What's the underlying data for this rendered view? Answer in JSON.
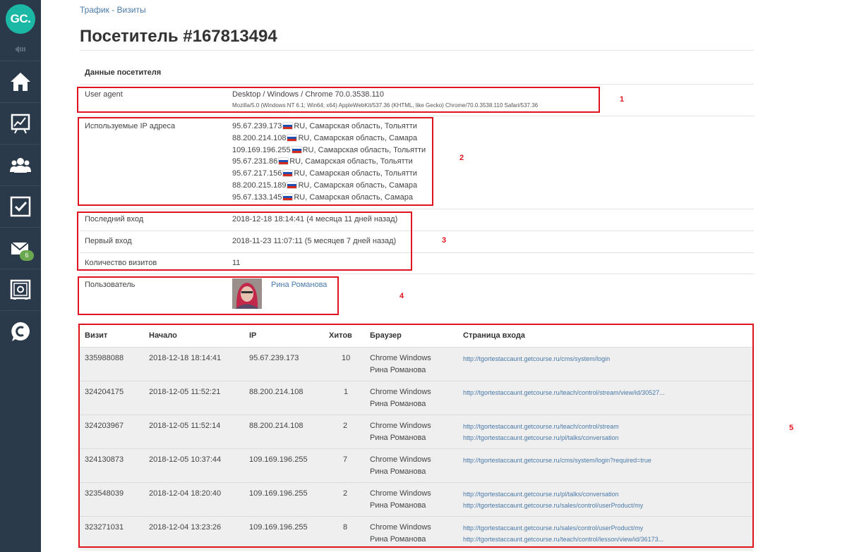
{
  "sidebar": {
    "logo_text": "GC.",
    "items": [
      {
        "icon": "home-icon"
      },
      {
        "icon": "chart-icon"
      },
      {
        "icon": "users-icon"
      },
      {
        "icon": "tasks-icon"
      },
      {
        "icon": "mail-icon",
        "badge": "6"
      },
      {
        "icon": "safe-icon"
      },
      {
        "icon": "chat-icon"
      }
    ],
    "bg_color": "#2b3a4a",
    "logo_color": "#1bb8a6"
  },
  "breadcrumb": {
    "item1": "Трафик",
    "sep": "-",
    "item2": "Визиты"
  },
  "page_title": "Посетитель #167813494",
  "visitor": {
    "section_title": "Данные посетителя",
    "user_agent_label": "User agent",
    "user_agent_short": "Desktop / Windows / Chrome 70.0.3538.110",
    "user_agent_full": "Mozilla/5.0 (Windows NT 6.1; Win64; x64) AppleWebKit/537.36 (KHTML, like Gecko) Chrome/70.0.3538.110 Safari/537.36",
    "ips_label": "Используемые IP адреса",
    "ips": [
      {
        "ip": "95.67.239.173",
        "loc": "RU, Самарская область, Тольятти"
      },
      {
        "ip": "88.200.214.108",
        "loc": "RU, Самарская область, Самара"
      },
      {
        "ip": "109.169.196.255",
        "loc": "RU, Самарская область, Тольятти"
      },
      {
        "ip": "95.67.231.86",
        "loc": "RU, Самарская область, Тольятти"
      },
      {
        "ip": "95.67.217.156",
        "loc": "RU, Самарская область, Тольятти"
      },
      {
        "ip": "88.200.215.189",
        "loc": "RU, Самарская область, Самара"
      },
      {
        "ip": "95.67.133.145",
        "loc": "RU, Самарская область, Самара"
      }
    ],
    "last_login_label": "Последний вход",
    "last_login": "2018-12-18 18:14:41 (4 месяца 11 дней назад)",
    "first_login_label": "Первый вход",
    "first_login": "2018-11-23 11:07:11 (5 месяцев 7 дней назад)",
    "visits_count_label": "Количество визитов",
    "visits_count": "11",
    "user_label": "Пользователь",
    "user_name": "Рина Романова"
  },
  "annotations": [
    "1",
    "2",
    "3",
    "4",
    "5"
  ],
  "visits_table": {
    "headers": [
      "Визит",
      "Начало",
      "IP",
      "Хитов",
      "Браузер",
      "Страница входа"
    ],
    "rows": [
      {
        "id": "335988088",
        "start": "2018-12-18 18:14:41",
        "ip": "95.67.239.173",
        "hits": "10",
        "browser": "Chrome Windows",
        "user": "Рина Романова",
        "pages": [
          "http://tgortestaccaunt.getcourse.ru/cms/system/login"
        ]
      },
      {
        "id": "324204175",
        "start": "2018-12-05 11:52:21",
        "ip": "88.200.214.108",
        "hits": "1",
        "browser": "Chrome Windows",
        "user": "Рина Романова",
        "pages": [
          "http://tgortestaccaunt.getcourse.ru/teach/control/stream/view/id/30527..."
        ]
      },
      {
        "id": "324203967",
        "start": "2018-12-05 11:52:14",
        "ip": "88.200.214.108",
        "hits": "2",
        "browser": "Chrome Windows",
        "user": "Рина Романова",
        "pages": [
          "http://tgortestaccaunt.getcourse.ru/teach/control/stream",
          "http://tgortestaccaunt.getcourse.ru/pl/talks/conversation"
        ]
      },
      {
        "id": "324130873",
        "start": "2018-12-05 10:37:44",
        "ip": "109.169.196.255",
        "hits": "7",
        "browser": "Chrome Windows",
        "user": "Рина Романова",
        "pages": [
          "http://tgortestaccaunt.getcourse.ru/cms/system/login?required=true"
        ]
      },
      {
        "id": "323548039",
        "start": "2018-12-04 18:20:40",
        "ip": "109.169.196.255",
        "hits": "2",
        "browser": "Chrome Windows",
        "user": "Рина Романова",
        "pages": [
          "http://tgortestaccaunt.getcourse.ru/pl/talks/conversation",
          "http://tgortestaccaunt.getcourse.ru/sales/control/userProduct/my"
        ]
      },
      {
        "id": "323271031",
        "start": "2018-12-04 13:23:26",
        "ip": "109.169.196.255",
        "hits": "8",
        "browser": "Chrome Windows",
        "user": "Рина Романова",
        "pages": [
          "http://tgortestaccaunt.getcourse.ru/sales/control/userProduct/my",
          "http://tgortestaccaunt.getcourse.ru/teach/control/lesson/view/id/36173..."
        ]
      }
    ]
  },
  "colors": {
    "link": "#4a7aa8",
    "annotation": "#e0141e",
    "row_bg": "#efefef"
  }
}
